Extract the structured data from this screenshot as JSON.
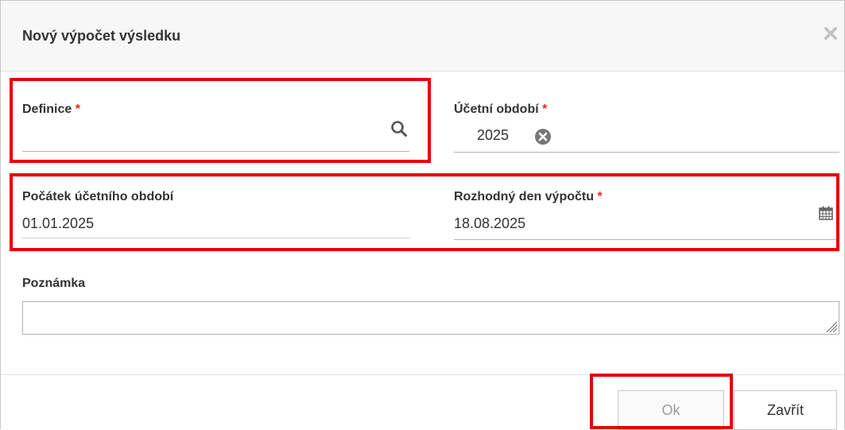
{
  "dialog": {
    "title": "Nový výpočet výsledku"
  },
  "form": {
    "definice": {
      "label": "Definice",
      "required_mark": "*",
      "value": ""
    },
    "ucetni_obdobi": {
      "label": "Účetní období",
      "required_mark": "*",
      "value": "2025"
    },
    "pocatek": {
      "label": "Počátek účetního období",
      "value": "01.01.2025"
    },
    "rozhodny_den": {
      "label": "Rozhodný den výpočtu",
      "required_mark": "*",
      "value": "18.08.2025"
    },
    "poznamka": {
      "label": "Poznámka",
      "value": ""
    }
  },
  "buttons": {
    "ok_label": "Ok",
    "close_label": "Zavřít"
  },
  "icons": {
    "close": "close-icon",
    "search": "search-icon",
    "clear": "clear-icon",
    "calendar": "calendar-icon",
    "resize": "resize-grip-icon"
  },
  "colors": {
    "highlight": "#e60000",
    "required": "#ee2222",
    "header_bg": "#f7f7f7"
  }
}
